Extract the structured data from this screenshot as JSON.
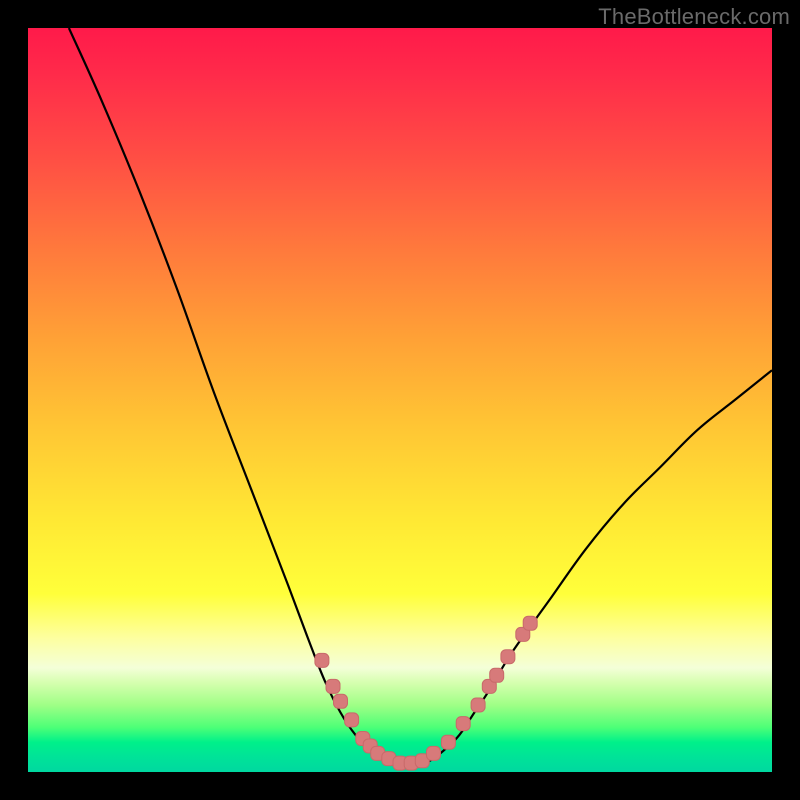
{
  "watermark": "TheBottleneck.com",
  "colors": {
    "frame": "#000000",
    "curve": "#000000",
    "marker_fill": "#d77a7a",
    "marker_stroke": "#c86a6a"
  },
  "chart_data": {
    "type": "line",
    "title": "",
    "xlabel": "",
    "ylabel": "",
    "xlim": [
      0,
      100
    ],
    "ylim": [
      0,
      100
    ],
    "curve": [
      {
        "x": 5.5,
        "y": 100
      },
      {
        "x": 10,
        "y": 90
      },
      {
        "x": 15,
        "y": 78
      },
      {
        "x": 20,
        "y": 65
      },
      {
        "x": 25,
        "y": 51
      },
      {
        "x": 30,
        "y": 38
      },
      {
        "x": 35,
        "y": 25
      },
      {
        "x": 38,
        "y": 17
      },
      {
        "x": 40,
        "y": 12
      },
      {
        "x": 42,
        "y": 8
      },
      {
        "x": 44,
        "y": 5
      },
      {
        "x": 46,
        "y": 3
      },
      {
        "x": 48,
        "y": 1.5
      },
      {
        "x": 50,
        "y": 1
      },
      {
        "x": 52,
        "y": 1
      },
      {
        "x": 54,
        "y": 1.5
      },
      {
        "x": 56,
        "y": 3
      },
      {
        "x": 58,
        "y": 5
      },
      {
        "x": 60,
        "y": 8
      },
      {
        "x": 62,
        "y": 11
      },
      {
        "x": 65,
        "y": 16
      },
      {
        "x": 70,
        "y": 23
      },
      {
        "x": 75,
        "y": 30
      },
      {
        "x": 80,
        "y": 36
      },
      {
        "x": 85,
        "y": 41
      },
      {
        "x": 90,
        "y": 46
      },
      {
        "x": 95,
        "y": 50
      },
      {
        "x": 100,
        "y": 54
      }
    ],
    "markers": [
      {
        "x": 39.5,
        "y": 15
      },
      {
        "x": 41,
        "y": 11.5
      },
      {
        "x": 42,
        "y": 9.5
      },
      {
        "x": 43.5,
        "y": 7
      },
      {
        "x": 45,
        "y": 4.5
      },
      {
        "x": 46,
        "y": 3.5
      },
      {
        "x": 47,
        "y": 2.5
      },
      {
        "x": 48.5,
        "y": 1.8
      },
      {
        "x": 50,
        "y": 1.2
      },
      {
        "x": 51.5,
        "y": 1.2
      },
      {
        "x": 53,
        "y": 1.5
      },
      {
        "x": 54.5,
        "y": 2.5
      },
      {
        "x": 56.5,
        "y": 4
      },
      {
        "x": 58.5,
        "y": 6.5
      },
      {
        "x": 60.5,
        "y": 9
      },
      {
        "x": 62,
        "y": 11.5
      },
      {
        "x": 63,
        "y": 13
      },
      {
        "x": 64.5,
        "y": 15.5
      },
      {
        "x": 66.5,
        "y": 18.5
      },
      {
        "x": 67.5,
        "y": 20
      }
    ]
  }
}
